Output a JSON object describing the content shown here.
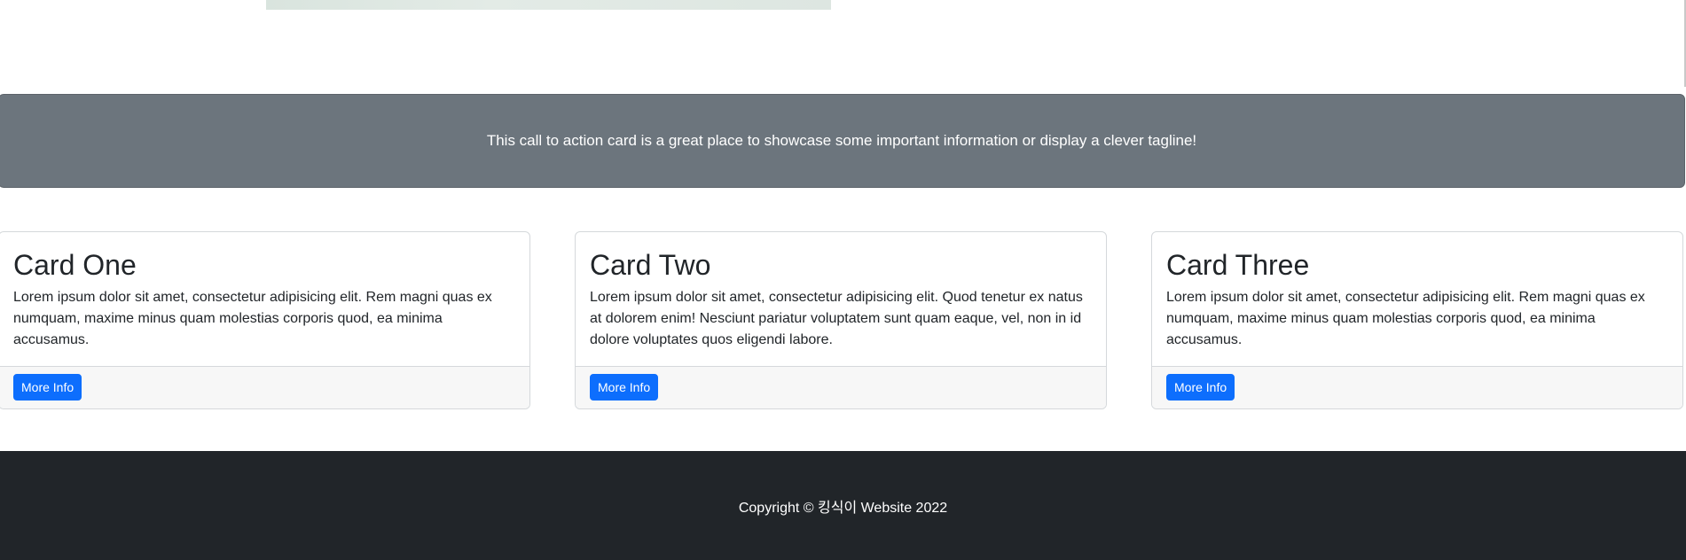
{
  "cta": {
    "text": "This call to action card is a great place to showcase some important information or display a clever tagline!"
  },
  "cards": [
    {
      "title": "Card One",
      "text": "Lorem ipsum dolor sit amet, consectetur adipisicing elit. Rem magni quas ex numquam, maxime minus quam molestias corporis quod, ea minima accusamus.",
      "button_label": "More Info"
    },
    {
      "title": "Card Two",
      "text": "Lorem ipsum dolor sit amet, consectetur adipisicing elit. Quod tenetur ex natus at dolorem enim! Nesciunt pariatur voluptatem sunt quam eaque, vel, non in id dolore voluptates quos eligendi labore.",
      "button_label": "More Info"
    },
    {
      "title": "Card Three",
      "text": "Lorem ipsum dolor sit amet, consectetur adipisicing elit. Rem magni quas ex numquam, maxime minus quam molestias corporis quod, ea minima accusamus.",
      "button_label": "More Info"
    }
  ],
  "footer": {
    "copyright": "Copyright © 킹식이 Website 2022"
  },
  "colors": {
    "cta_background": "#6c757d",
    "button_primary": "#0d6efd",
    "footer_background": "#212529",
    "card_footer_background": "#f7f7f7"
  }
}
